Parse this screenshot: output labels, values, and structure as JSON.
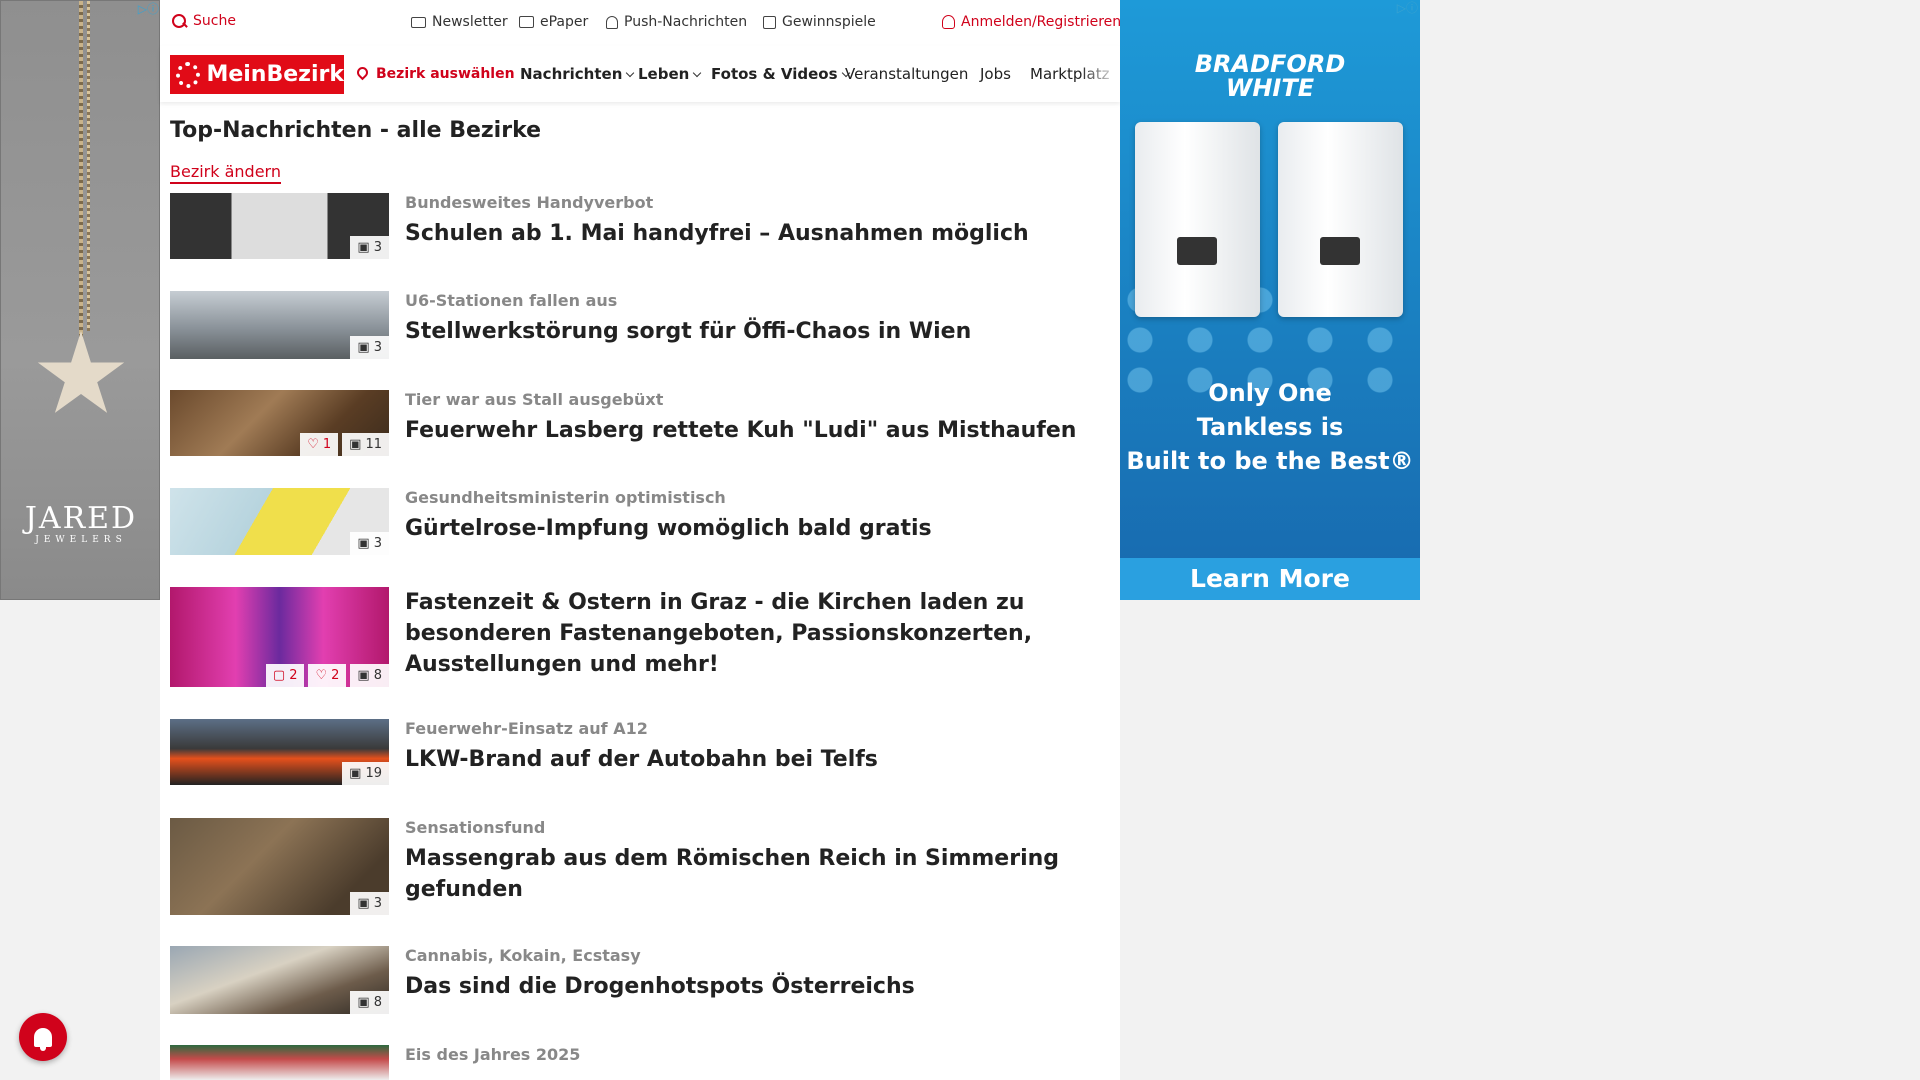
{
  "ads": {
    "left": {
      "brand": "JARED",
      "brand_sub": "JEWELERS",
      "adchoice": "▷ⓘ"
    },
    "right": {
      "brand_line1": "BRADFORD",
      "brand_line2": "WHITE",
      "tagline_1": "Only One",
      "tagline_2": "Tankless is",
      "tagline_3": "Built to be the Best®",
      "cta": "Learn More",
      "adchoice": "▷ⓘ"
    }
  },
  "topbar": {
    "search": "Suche",
    "newsletter": "Newsletter",
    "epaper": "ePaper",
    "push": "Push-Nachrichten",
    "games": "Gewinnspiele",
    "login": "Anmelden/Registrieren"
  },
  "nav": {
    "logo": "MeinBezirk",
    "district": "Bezirk auswählen",
    "items": [
      "Nachrichten",
      "Leben",
      "Fotos & Videos",
      "Veranstaltungen",
      "Jobs",
      "Marktplatz"
    ]
  },
  "page": {
    "title": "Top-Nachrichten - alle Bezirke",
    "change_district": "Bezirk ändern"
  },
  "articles": [
    {
      "kicker": "Bundesweites Handyverbot",
      "headline": "Schulen ab 1. Mai handyfrei – Ausnahmen möglich",
      "images": "3"
    },
    {
      "kicker": "U6-Stationen fallen aus",
      "headline": "Stellwerkstörung sorgt für Öffi-Chaos in Wien",
      "images": "3"
    },
    {
      "kicker": "Tier war aus Stall ausgebüxt",
      "headline": "Feuerwehr Lasberg rettete Kuh \"Ludi\" aus Misthaufen",
      "likes": "1",
      "images": "11"
    },
    {
      "kicker": "Gesundheitsministerin optimistisch",
      "headline": "Gürtelrose-Impfung womöglich bald gratis",
      "images": "3"
    },
    {
      "kicker": "",
      "headline": "Fastenzeit & Ostern in Graz - die Kirchen laden zu besonderen Fastenangeboten, Passionskonzerten, Ausstellungen und mehr!",
      "comments": "2",
      "likes": "2",
      "images": "8"
    },
    {
      "kicker": "Feuerwehr-Einsatz auf A12",
      "headline": "LKW-Brand auf der Autobahn bei Telfs",
      "images": "19"
    },
    {
      "kicker": "Sensationsfund",
      "headline": "Massengrab aus dem Römischen Reich in Simmering gefunden",
      "images": "3"
    },
    {
      "kicker": "Cannabis, Kokain, Ecstasy",
      "headline": "Das sind die Drogenhotspots Österreichs",
      "images": "8"
    },
    {
      "kicker": "Eis des Jahres 2025",
      "headline": ""
    }
  ]
}
